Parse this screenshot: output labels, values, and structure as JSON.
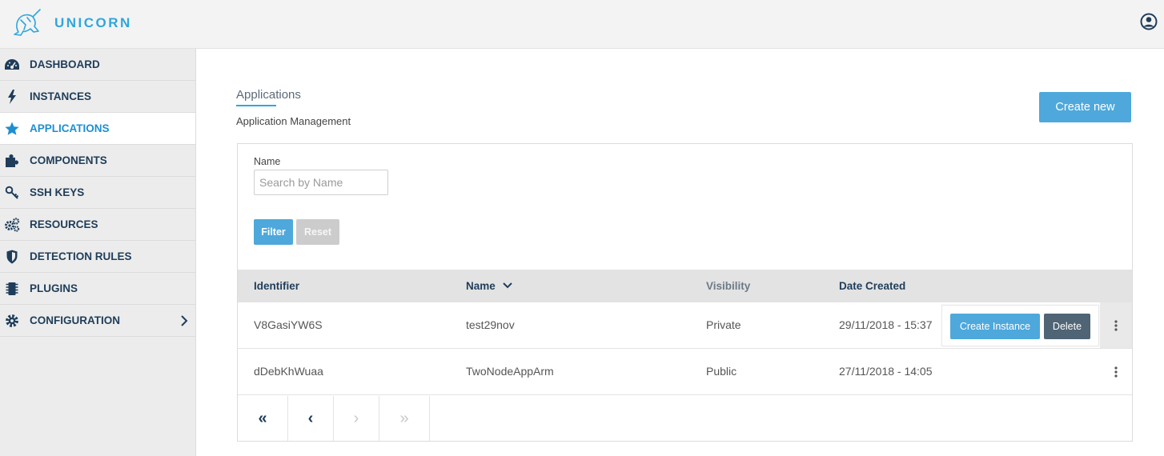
{
  "app": {
    "brand": "UNICORN"
  },
  "sidebar": {
    "items": [
      {
        "label": "DASHBOARD",
        "icon": "dashboard-gauge-icon"
      },
      {
        "label": "INSTANCES",
        "icon": "bolt-icon"
      },
      {
        "label": "APPLICATIONS",
        "icon": "star-icon",
        "active": true
      },
      {
        "label": "COMPONENTS",
        "icon": "puzzle-icon"
      },
      {
        "label": "SSH KEYS",
        "icon": "key-icon"
      },
      {
        "label": "RESOURCES",
        "icon": "gears-icon"
      },
      {
        "label": "DETECTION RULES",
        "icon": "shield-icon"
      },
      {
        "label": "PLUGINS",
        "icon": "chip-icon"
      },
      {
        "label": "CONFIGURATION",
        "icon": "gear-icon",
        "has_submenu": true
      }
    ]
  },
  "page": {
    "title": "Applications",
    "subtitle": "Application Management",
    "create_label": "Create new"
  },
  "filter": {
    "name_label": "Name",
    "name_placeholder": "Search by Name",
    "name_value": "",
    "filter_label": "Filter",
    "reset_label": "Reset"
  },
  "table": {
    "columns": [
      "Identifier",
      "Name",
      "Visibility",
      "Date Created"
    ],
    "sorted_column": "Name",
    "rows": [
      {
        "identifier": "V8GasiYW6S",
        "name": "test29nov",
        "visibility": "Private",
        "date": "29/11/2018 - 15:37"
      },
      {
        "identifier": "dDebKhWuaa",
        "name": "TwoNodeAppArm",
        "visibility": "Public",
        "date": "27/11/2018 - 14:05"
      }
    ],
    "row_actions": {
      "create_instance": "Create Instance",
      "delete": "Delete"
    }
  },
  "pagination": {
    "first": "«",
    "prev": "‹",
    "next": "›",
    "last": "»"
  },
  "colors": {
    "accent": "#2fa6dd",
    "primary_button": "#4ea8db",
    "delete_button": "#4f6475",
    "nav_text": "#1f3d5a"
  }
}
